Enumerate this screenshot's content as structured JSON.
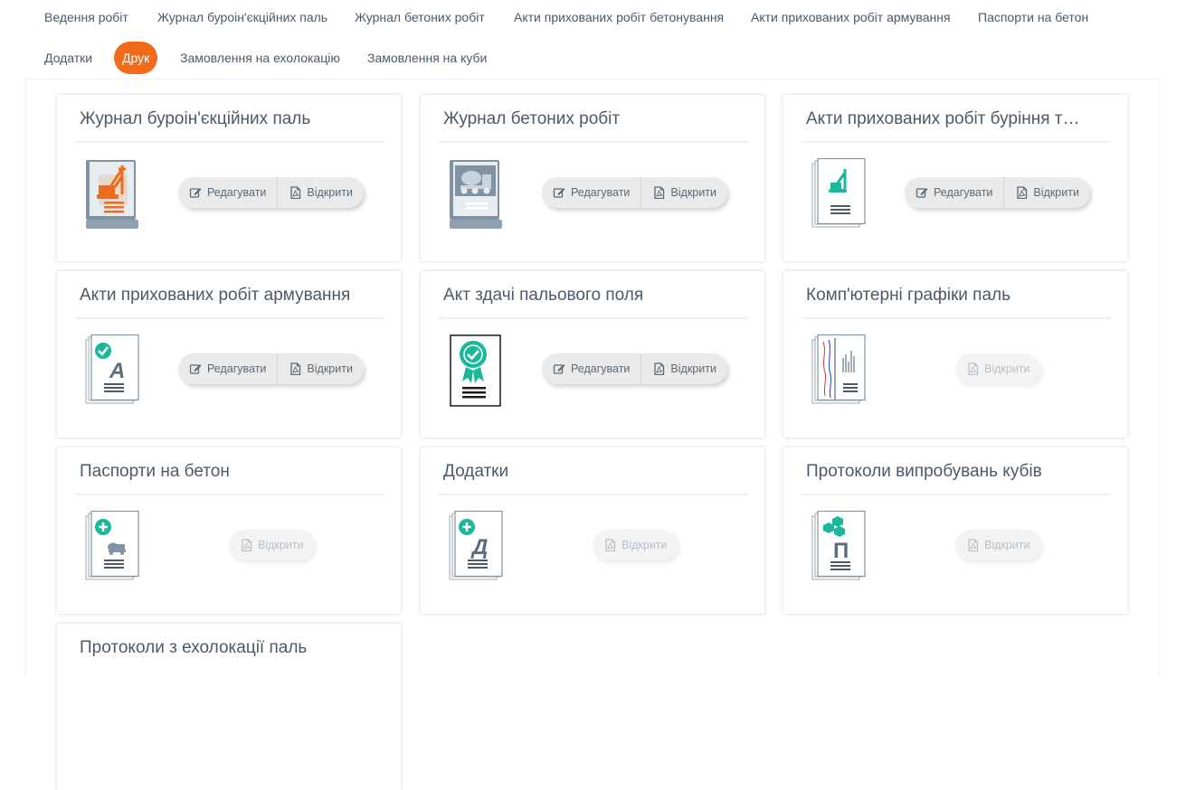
{
  "nav": {
    "tabs": [
      {
        "label": "Ведення робіт",
        "active": false
      },
      {
        "label": "Журнал буроін'єкційних паль",
        "active": false
      },
      {
        "label": "Журнал бетоних робіт",
        "active": false
      },
      {
        "label": "Акти прихованих робіт бетонування",
        "active": false
      },
      {
        "label": "Акти прихованих робіт армування",
        "active": false
      },
      {
        "label": "Паспорти на бетон",
        "active": false
      },
      {
        "label": "Додатки",
        "active": false
      },
      {
        "label": "Друк",
        "active": true
      },
      {
        "label": "Замовлення на ехолокацію",
        "active": false
      },
      {
        "label": "Замовлення на куби",
        "active": false
      }
    ]
  },
  "buttons": {
    "edit_label": "Редагувати",
    "open_label": "Відкрити"
  },
  "cards": [
    {
      "title": "Журнал буроін'єкційних паль",
      "icon": "pile-rig-book-icon",
      "edit": true
    },
    {
      "title": "Журнал бетоних робіт",
      "icon": "concrete-mixer-book-icon",
      "edit": true
    },
    {
      "title": "Акти прихованих робіт буріння т…",
      "icon": "drilling-act-document-icon",
      "edit": true
    },
    {
      "title": "Акти прихованих робіт армування",
      "icon": "reinforcement-act-document-icon",
      "edit": true
    },
    {
      "title": "Акт здачі пальового поля",
      "icon": "certificate-ribbon-icon",
      "edit": true
    },
    {
      "title": "Комп'ютерні графіки паль",
      "icon": "pile-graph-document-icon",
      "edit": false
    },
    {
      "title": "Паспорти на бетон",
      "icon": "concrete-passport-document-icon",
      "edit": false
    },
    {
      "title": "Додатки",
      "icon": "appendix-document-icon",
      "edit": false
    },
    {
      "title": "Протоколи випробувань кубів",
      "icon": "cube-test-protocol-icon",
      "edit": false
    },
    {
      "title": "Протоколи з ехолокації паль",
      "icon": "",
      "edit": false
    }
  ],
  "colors": {
    "accent": "#f26a1b",
    "teal": "#1ab89a",
    "slate": "#7f93a4"
  }
}
